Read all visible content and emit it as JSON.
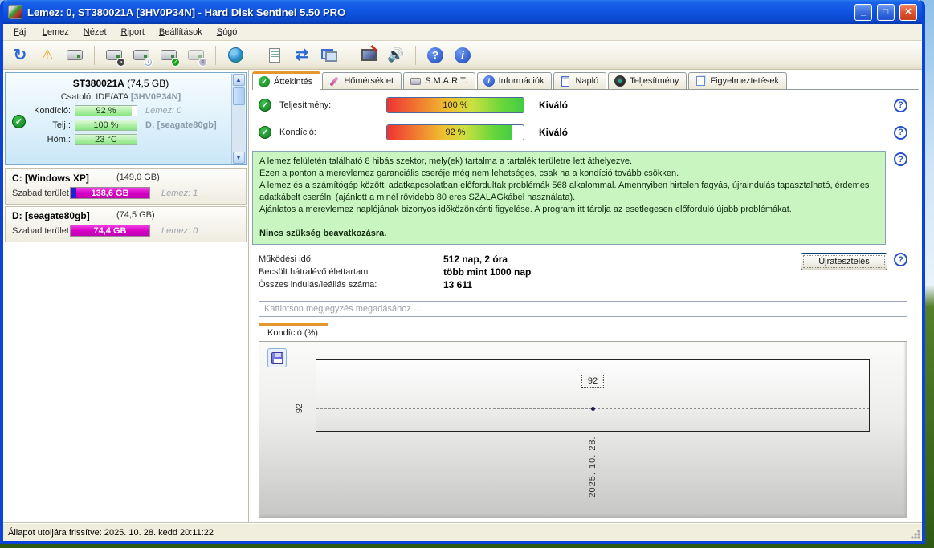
{
  "window": {
    "title": "Lemez: 0, ST380021A [3HV0P34N]  -  Hard Disk Sentinel 5.50 PRO",
    "controls": {
      "minimize": "_",
      "maximize": "□",
      "close": "✕"
    }
  },
  "menu": {
    "items": [
      "Fájl",
      "Lemez",
      "Nézet",
      "Riport",
      "Beállítások",
      "Súgó"
    ]
  },
  "toolbar": {
    "icons": [
      "refresh-icon",
      "warning-icon",
      "disk-view-icon",
      "disk-gauge-icon",
      "disk-clock-icon",
      "disk-check-icon",
      "disk-search-icon",
      "network-disk-icon",
      "report-icon",
      "sync-icon",
      "network-computers-icon",
      "remote-monitor-icon",
      "sound-icon",
      "help-icon",
      "info-icon"
    ]
  },
  "sidebar": {
    "disk": {
      "name": "ST380021A",
      "size": "(74,5 GB)",
      "interface_label": "Csatoló:",
      "interface": "IDE/ATA",
      "interface_id": "[3HV0P34N]",
      "rows": [
        {
          "label": "Kondíció:",
          "value": "92 %",
          "percent": 92,
          "note": "Lemez: 0"
        },
        {
          "label": "Telj.:",
          "value": "100 %",
          "percent": 100,
          "note": "D: [seagate80gb]"
        },
        {
          "label": "Hőm.:",
          "value": "23 °C",
          "percent": 100,
          "note": ""
        }
      ]
    },
    "partitions": [
      {
        "name": "C: [Windows XP]",
        "size": "(149,0 GB)",
        "free_label": "Szabad terület",
        "free_value": "138,6 GB",
        "note": "Lemez: 1"
      },
      {
        "name": "D: [seagate80gb]",
        "size": "(74,5 GB)",
        "free_label": "Szabad terület",
        "free_value": "74,4 GB",
        "note": "Lemez: 0"
      }
    ]
  },
  "tabs": [
    {
      "label": "Áttekintés",
      "icon": "check-circle-icon",
      "active": true
    },
    {
      "label": "Hőmérséklet",
      "icon": "thermometer-icon",
      "active": false
    },
    {
      "label": "S.M.A.R.T.",
      "icon": "disk-icon",
      "active": false
    },
    {
      "label": "Információk",
      "icon": "info-icon",
      "active": false
    },
    {
      "label": "Napló",
      "icon": "document-icon",
      "active": false
    },
    {
      "label": "Teljesítmény",
      "icon": "gauge-icon",
      "active": false
    },
    {
      "label": "Figyelmeztetések",
      "icon": "pages-icon",
      "active": false
    }
  ],
  "overview": {
    "metrics": [
      {
        "label": "Teljesítmény:",
        "value": "100 %",
        "percent": 100,
        "rating": "Kiváló"
      },
      {
        "label": "Kondíció:",
        "value": "92 %",
        "percent": 92,
        "rating": "Kiváló"
      }
    ],
    "message_lines": [
      "A lemez felületén található 8 hibás szektor, mely(ek) tartalma a tartalék területre lett áthelyezve.",
      "Ezen a ponton a merevlemez garanciális cseréje még nem lehetséges, csak ha a kondíció tovább csökken.",
      "A lemez és a számítógép közötti adatkapcsolatban előfordultak problémák 568 alkalommal. Amennyiben hirtelen fagyás, újraindulás tapasztalható, érdemes adatkábelt cserélni (ajánlott a minél rövidebb 80 eres SZALAGkábel használata).",
      "Ajánlatos a merevlemez naplójának bizonyos időközönkénti figyelése. A program itt tárolja az esetlegesen előforduló újabb problémákat."
    ],
    "action_line": "Nincs szükség beavatkozásra.",
    "stats": [
      {
        "label": "Működési idő:",
        "value": "512 nap, 2 óra"
      },
      {
        "label": "Becsült hátralévő élettartam:",
        "value": "több mint 1000 nap"
      },
      {
        "label": "Összes indulás/leállás száma:",
        "value": "13 611"
      }
    ],
    "retest_button": "Újratesztelés",
    "comment_placeholder": "Kattintson megjegyzés megadásához ..."
  },
  "chart": {
    "tab_label": "Kondíció  (%)",
    "save_icon": "save-floppy-icon"
  },
  "chart_data": {
    "type": "line",
    "title": "Kondíció (%)",
    "x": [
      "2025. 10. 28."
    ],
    "values": [
      92
    ],
    "point_label": "92",
    "y_tick": "92",
    "x_tick": "2025. 10. 28.",
    "legend": "none",
    "grid": "dashed crosshair at single data point"
  },
  "statusbar": {
    "text": "Állapot utoljára frissítve: 2025. 10. 28. kedd 20:11:22"
  },
  "colors": {
    "titlebar_blue": "#0f55e2",
    "window_border": "#0a44d8",
    "green_box_bg": "#c9f6c0",
    "bar_gradient": "red-yellow-green",
    "free_space_bar": "#d800c8",
    "sidebar_bar_green": "#a8eea0",
    "selected_tab_accent": "#e5962c"
  }
}
